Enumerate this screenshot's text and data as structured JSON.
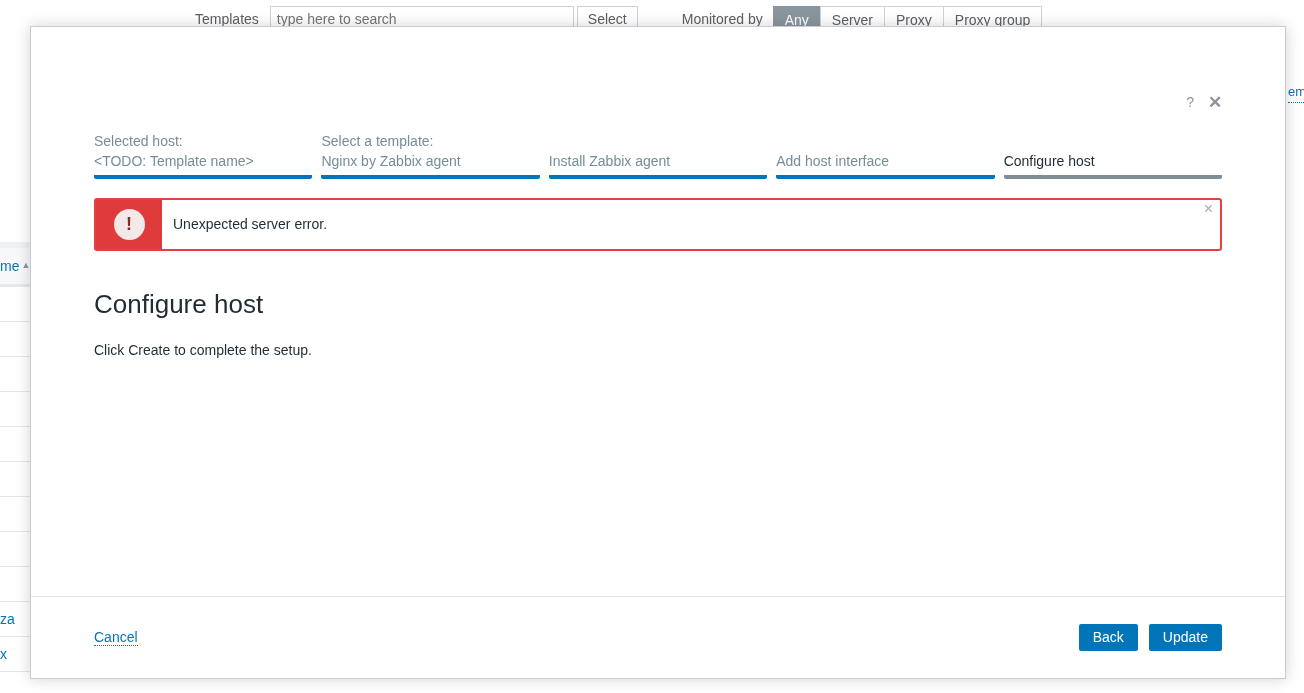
{
  "background_page": {
    "filter": {
      "templates_label": "Templates",
      "templates_placeholder": "type here to search",
      "select_button": "Select",
      "monitored_by_label": "Monitored by",
      "monitored_by_options": [
        {
          "label": "Any",
          "selected": true
        },
        {
          "label": "Server",
          "selected": false
        },
        {
          "label": "Proxy",
          "selected": false
        },
        {
          "label": "Proxy group",
          "selected": false
        }
      ]
    },
    "right_link": "em",
    "table": {
      "header": "me",
      "sort_icon": "▲",
      "rows": [
        "za",
        "x"
      ]
    }
  },
  "dialog": {
    "help_icon": "?",
    "close_icon": "✕",
    "steps": [
      {
        "label": "Selected host:",
        "value": "<TODO: Template name>",
        "selected": false
      },
      {
        "label": "Select a template:",
        "value": "Nginx by Zabbix agent",
        "selected": false
      },
      {
        "value": "Install Zabbix agent",
        "selected": false
      },
      {
        "value": "Add host interface",
        "selected": false
      },
      {
        "value": "Configure host",
        "selected": true
      }
    ],
    "error": {
      "icon": "!",
      "message": "Unexpected server error.",
      "close": "×"
    },
    "heading": "Configure host",
    "description": "Click Create to complete the setup.",
    "footer": {
      "cancel": "Cancel",
      "buttons": [
        "Back",
        "Update"
      ]
    }
  }
}
